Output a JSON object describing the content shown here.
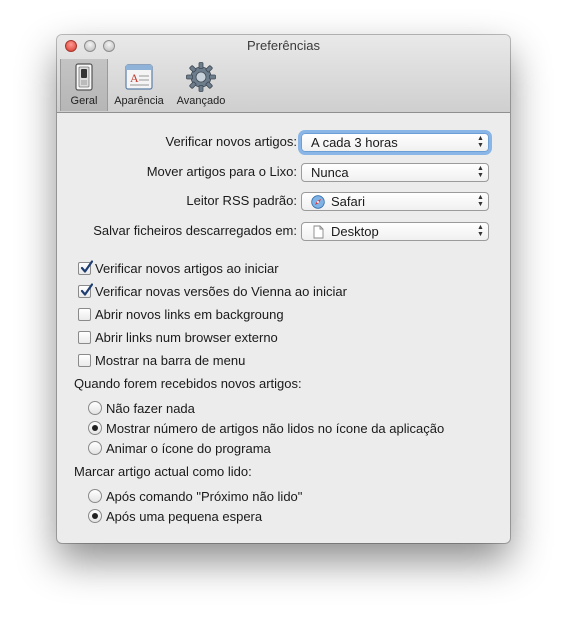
{
  "window": {
    "title": "Preferências"
  },
  "toolbar": {
    "tabs": [
      {
        "label": "Geral",
        "icon": "switch-icon",
        "selected": true
      },
      {
        "label": "Aparência",
        "icon": "appearance-icon",
        "selected": false
      },
      {
        "label": "Avançado",
        "icon": "gear-icon",
        "selected": false
      }
    ]
  },
  "general": {
    "check_articles": {
      "label": "Verificar novos artigos:",
      "value": "A cada 3 horas"
    },
    "move_to_trash": {
      "label": "Mover artigos para o Lixo:",
      "value": "Nunca"
    },
    "rss_reader": {
      "label": "Leitor RSS padrão:",
      "value": "Safari",
      "icon": "safari-icon"
    },
    "save_downloads": {
      "label": "Salvar ficheiros descarregados em:",
      "value": "Desktop",
      "icon": "document-icon"
    }
  },
  "checkboxes": [
    {
      "label": "Verificar novos artigos ao iniciar",
      "checked": true
    },
    {
      "label": "Verificar novas versões do Vienna ao iniciar",
      "checked": true
    },
    {
      "label": "Abrir novos links em backgroung",
      "checked": false
    },
    {
      "label": "Abrir links num browser externo",
      "checked": false
    },
    {
      "label": "Mostrar na barra de menu",
      "checked": false
    }
  ],
  "new_articles": {
    "title": "Quando forem recebidos novos artigos:",
    "options": [
      {
        "label": "Não fazer nada",
        "selected": false
      },
      {
        "label": "Mostrar número de artigos não lidos no ícone da aplicação",
        "selected": true
      },
      {
        "label": "Animar o ícone do programa",
        "selected": false
      }
    ]
  },
  "mark_read": {
    "title": "Marcar artigo actual como lido:",
    "options": [
      {
        "label": "Após comando \"Próximo não lido\"",
        "selected": false
      },
      {
        "label": "Após uma pequena espera",
        "selected": true
      }
    ]
  },
  "colors": {
    "focus_ring": "#60a0e4",
    "close_button": "#d6382d"
  }
}
